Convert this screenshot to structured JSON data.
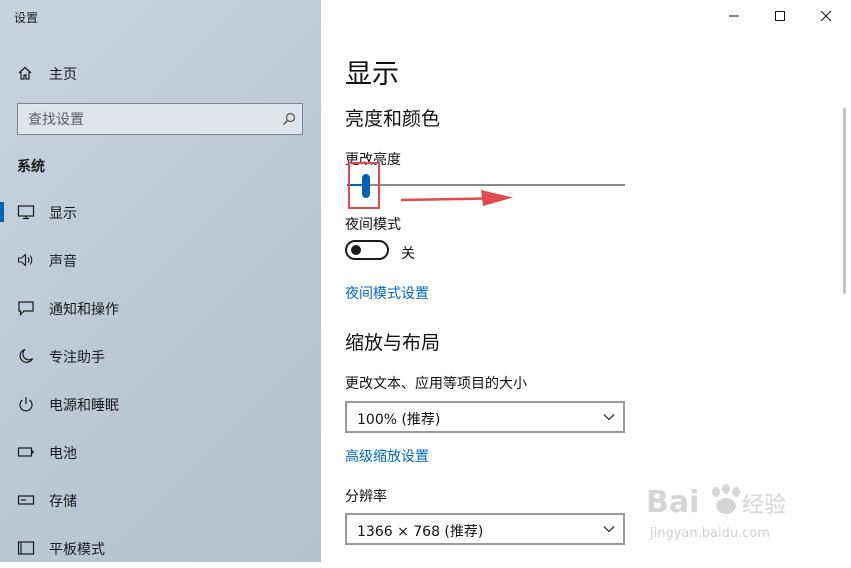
{
  "window": {
    "title": "设置",
    "controls": {
      "minimize": "minimize-icon",
      "maximize": "maximize-icon",
      "close": "close-icon"
    }
  },
  "sidebar": {
    "home_label": "主页",
    "search_placeholder": "查找设置",
    "section_title": "系统",
    "items": [
      {
        "label": "显示",
        "icon": "monitor-icon",
        "active": true
      },
      {
        "label": "声音",
        "icon": "speaker-icon"
      },
      {
        "label": "通知和操作",
        "icon": "notification-icon"
      },
      {
        "label": "专注助手",
        "icon": "moon-icon"
      },
      {
        "label": "电源和睡眠",
        "icon": "power-icon"
      },
      {
        "label": "电池",
        "icon": "battery-icon"
      },
      {
        "label": "存储",
        "icon": "storage-icon"
      },
      {
        "label": "平板模式",
        "icon": "tablet-icon"
      }
    ]
  },
  "main": {
    "page_title": "显示",
    "brightness": {
      "heading": "亮度和颜色",
      "slider_label": "更改亮度",
      "value_fraction": 0.07
    },
    "night_mode": {
      "label": "夜间模式",
      "state": "关",
      "settings_link": "夜间模式设置"
    },
    "scale_layout": {
      "heading": "缩放与布局",
      "scale_label": "更改文本、应用等项目的大小",
      "scale_value": "100% (推荐)",
      "advanced_link": "高级缩放设置",
      "resolution_label": "分辨率",
      "resolution_value": "1366 × 768 (推荐)"
    }
  },
  "annotation": {
    "highlight_color": "#e24a4f",
    "arrow_color": "#e24a4f"
  },
  "colors": {
    "accent": "#0063b1",
    "link": "#0067c0"
  },
  "watermark": {
    "brand": "Bai",
    "brand_cn": "经验",
    "url": "jingyan.baidu.com"
  }
}
